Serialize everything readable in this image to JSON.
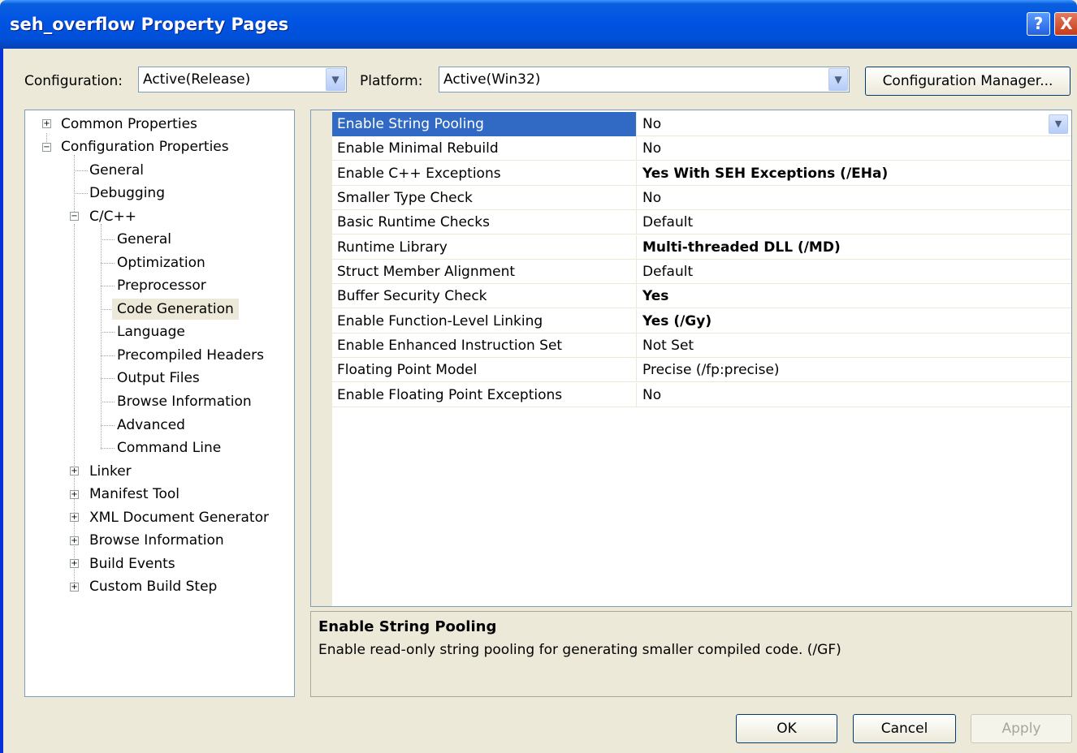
{
  "window": {
    "title": "seh_overflow Property Pages",
    "help_glyph": "?",
    "close_glyph": "X"
  },
  "toolbar": {
    "configuration_label": "Configuration:",
    "configuration_value": "Active(Release)",
    "platform_label": "Platform:",
    "platform_value": "Active(Win32)",
    "config_manager_label": "Configuration Manager..."
  },
  "tree": {
    "common_properties": "Common Properties",
    "configuration_properties": "Configuration Properties",
    "general": "General",
    "debugging": "Debugging",
    "ccpp": "C/C++",
    "ccpp_children": [
      "General",
      "Optimization",
      "Preprocessor",
      "Code Generation",
      "Language",
      "Precompiled Headers",
      "Output Files",
      "Browse Information",
      "Advanced",
      "Command Line"
    ],
    "after": [
      "Linker",
      "Manifest Tool",
      "XML Document Generator",
      "Browse Information",
      "Build Events",
      "Custom Build Step"
    ],
    "selected": "Code Generation"
  },
  "properties": [
    {
      "name": "Enable String Pooling",
      "value": "No",
      "bold": false,
      "selected": true
    },
    {
      "name": "Enable Minimal Rebuild",
      "value": "No",
      "bold": false
    },
    {
      "name": "Enable C++ Exceptions",
      "value": "Yes With SEH Exceptions (/EHa)",
      "bold": true
    },
    {
      "name": "Smaller Type Check",
      "value": "No",
      "bold": false
    },
    {
      "name": "Basic Runtime Checks",
      "value": "Default",
      "bold": false
    },
    {
      "name": "Runtime Library",
      "value": "Multi-threaded DLL (/MD)",
      "bold": true
    },
    {
      "name": "Struct Member Alignment",
      "value": "Default",
      "bold": false
    },
    {
      "name": "Buffer Security Check",
      "value": "Yes",
      "bold": true
    },
    {
      "name": "Enable Function-Level Linking",
      "value": "Yes (/Gy)",
      "bold": true
    },
    {
      "name": "Enable Enhanced Instruction Set",
      "value": "Not Set",
      "bold": false
    },
    {
      "name": "Floating Point Model",
      "value": "Precise (/fp:precise)",
      "bold": false
    },
    {
      "name": "Enable Floating Point Exceptions",
      "value": "No",
      "bold": false
    }
  ],
  "description": {
    "title": "Enable String Pooling",
    "text": "Enable read-only string pooling for generating smaller compiled code.     (/GF)"
  },
  "buttons": {
    "ok": "OK",
    "cancel": "Cancel",
    "apply": "Apply"
  },
  "colors": {
    "title_bar": "#0054e3",
    "selection": "#316ac5",
    "dialog_bg": "#ece9d8"
  }
}
